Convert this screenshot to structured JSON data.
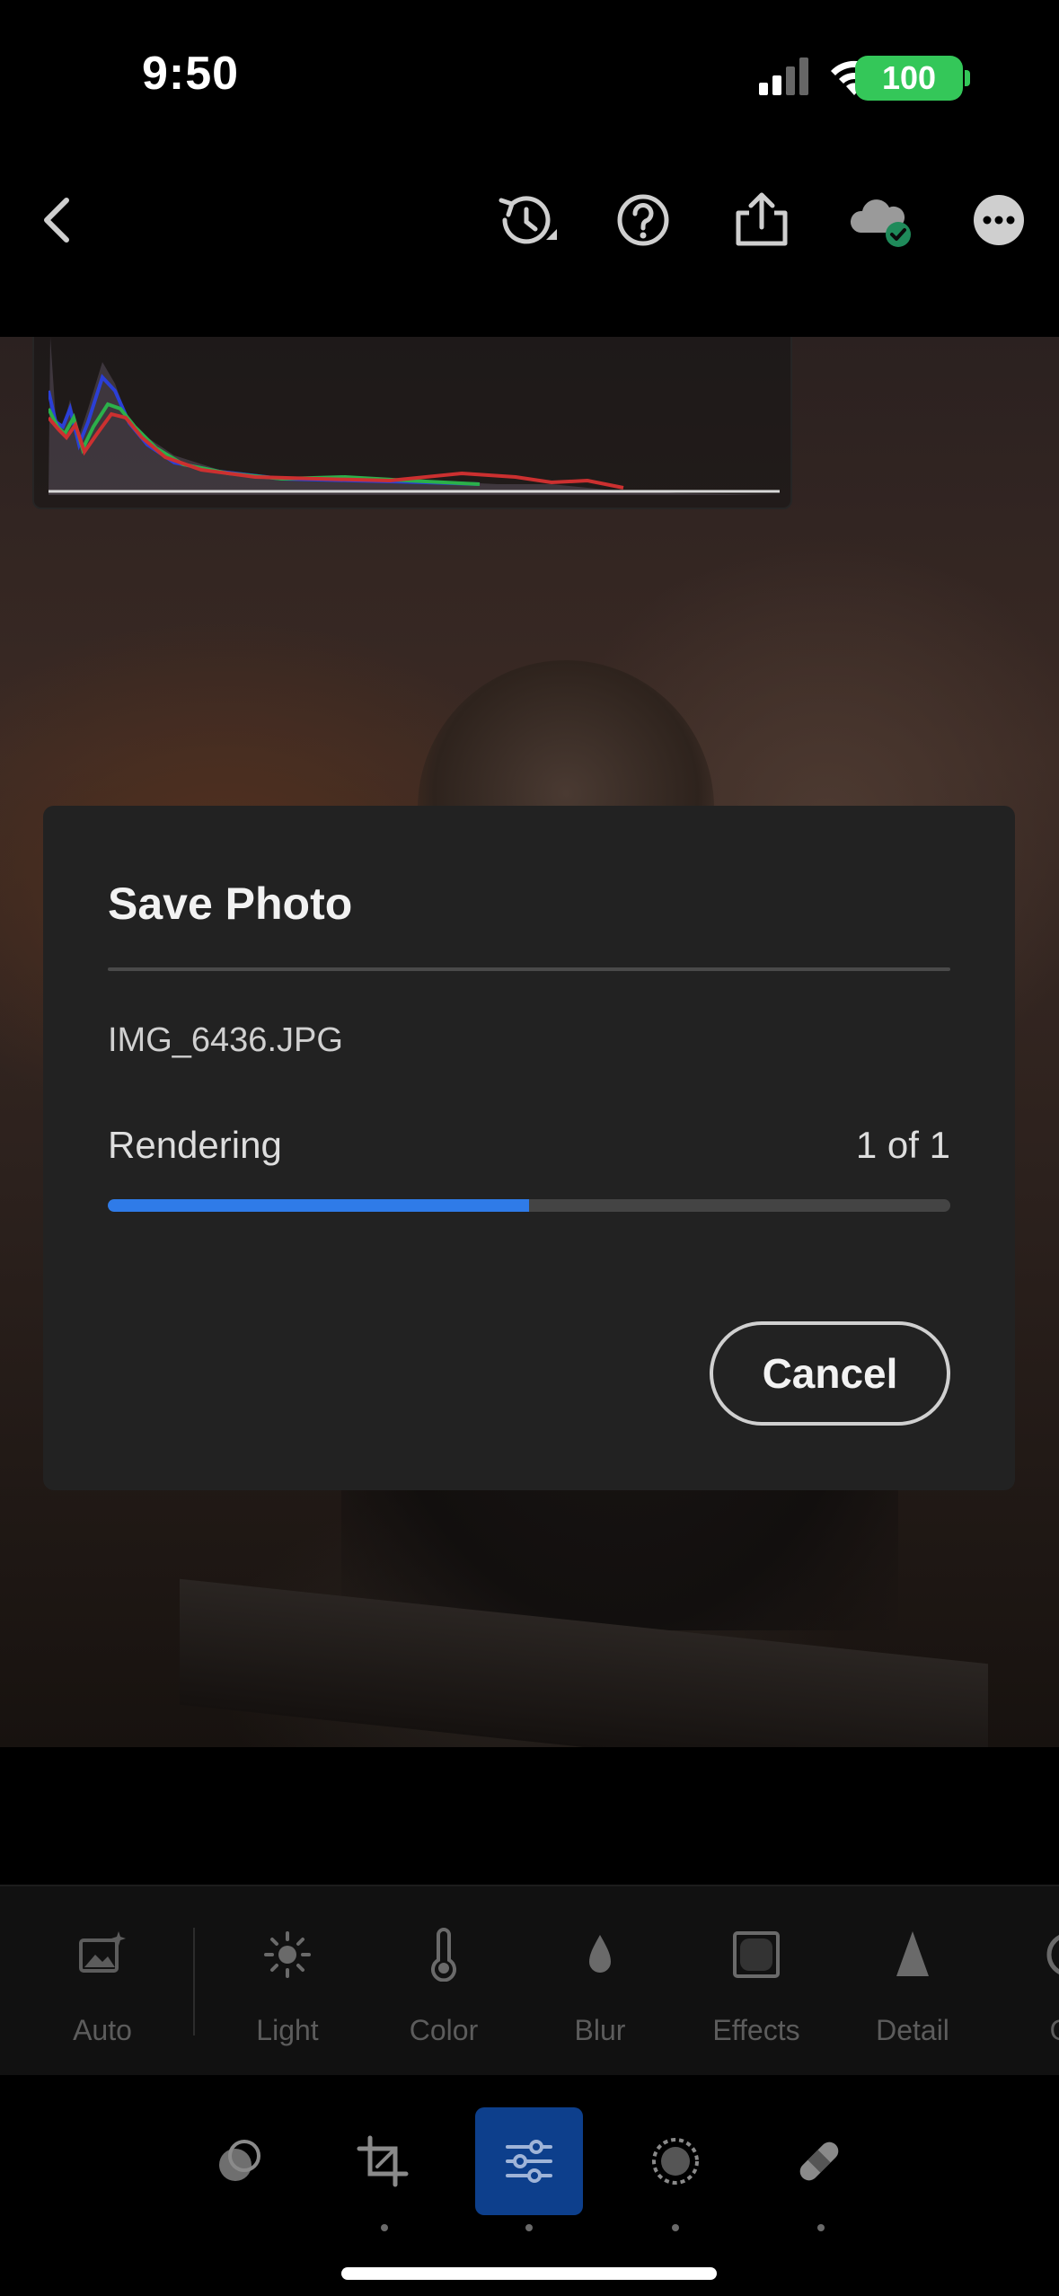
{
  "status_bar": {
    "time": "9:50",
    "battery": "100",
    "icons": [
      "cellular-signal-icon",
      "wifi-icon",
      "battery-icon"
    ]
  },
  "toolbar": {
    "icons": [
      "back-chevron-icon",
      "history-icon",
      "help-icon",
      "share-icon",
      "cloud-sync-icon",
      "more-icon"
    ]
  },
  "dialog": {
    "title": "Save Photo",
    "filename": "IMG_6436.JPG",
    "status": "Rendering",
    "count": "1 of 1",
    "progress": 0.5,
    "cancel_label": "Cancel",
    "progress_color": "#2f7be8"
  },
  "edit_tools": {
    "items": [
      {
        "label": "Auto",
        "icon": "auto-icon"
      },
      {
        "label": "Light",
        "icon": "light-icon"
      },
      {
        "label": "Color",
        "icon": "color-icon"
      },
      {
        "label": "Blur",
        "icon": "blur-icon"
      },
      {
        "label": "Effects",
        "icon": "effects-icon"
      },
      {
        "label": "Detail",
        "icon": "detail-icon"
      },
      {
        "label": "Op",
        "icon": "optics-icon"
      }
    ]
  },
  "bottom_nav": {
    "items": [
      {
        "icon": "presets-icon",
        "active": false
      },
      {
        "icon": "crop-icon",
        "active": false
      },
      {
        "icon": "edit-sliders-icon",
        "active": true
      },
      {
        "icon": "masking-icon",
        "active": false
      },
      {
        "icon": "healing-icon",
        "active": false
      }
    ],
    "active_color": "#0d3f8c"
  }
}
